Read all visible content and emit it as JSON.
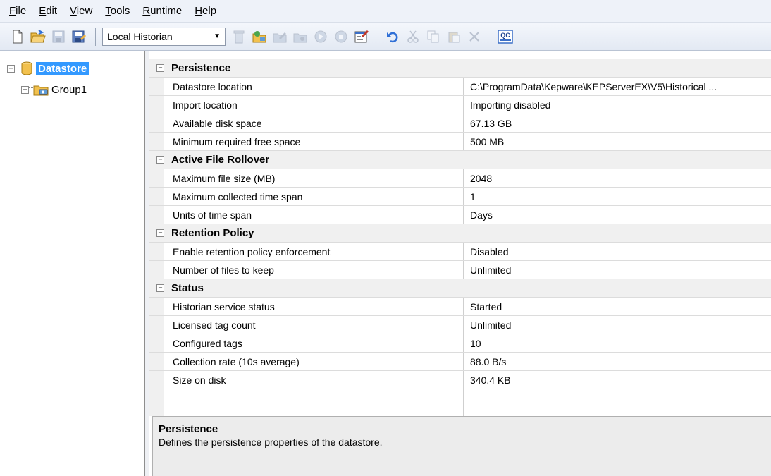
{
  "menu": [
    {
      "label": "File",
      "underline": "F",
      "rest": "ile"
    },
    {
      "label": "Edit",
      "underline": "E",
      "rest": "dit"
    },
    {
      "label": "View",
      "underline": "V",
      "rest": "iew"
    },
    {
      "label": "Tools",
      "underline": "T",
      "rest": "ools"
    },
    {
      "label": "Runtime",
      "underline": "R",
      "rest": "untime"
    },
    {
      "label": "Help",
      "underline": "H",
      "rest": "elp"
    }
  ],
  "toolbar": {
    "project_select": "Local Historian",
    "icons": [
      "new-icon",
      "open-icon",
      "save-icon",
      "save-as-icon",
      "delete-icon",
      "new-group-icon",
      "edit-icon",
      "new-tag-icon",
      "start-icon",
      "stop-icon",
      "properties-icon",
      "undo-icon",
      "cut-icon",
      "copy-icon",
      "paste-icon",
      "remove-icon",
      "quick-client-icon"
    ],
    "quick_client_label": "QC"
  },
  "tree": {
    "root": "Datastore",
    "child": "Group1"
  },
  "properties": {
    "persistence": {
      "title": "Persistence",
      "rows": [
        {
          "name": "Datastore location",
          "value": "C:\\ProgramData\\Kepware\\KEPServerEX\\V5\\Historical ..."
        },
        {
          "name": "Import location",
          "value": "Importing disabled"
        },
        {
          "name": "Available disk space",
          "value": "67.13 GB"
        },
        {
          "name": "Minimum required free space",
          "value": "500 MB"
        }
      ]
    },
    "rollover": {
      "title": "Active File Rollover",
      "rows": [
        {
          "name": "Maximum file size (MB)",
          "value": "2048"
        },
        {
          "name": "Maximum collected time span",
          "value": "1"
        },
        {
          "name": "Units of time span",
          "value": "Days"
        }
      ]
    },
    "retention": {
      "title": "Retention Policy",
      "rows": [
        {
          "name": "Enable retention policy enforcement",
          "value": "Disabled"
        },
        {
          "name": "Number of files to keep",
          "value": "Unlimited"
        }
      ]
    },
    "status": {
      "title": "Status",
      "rows": [
        {
          "name": "Historian service status",
          "value": "Started"
        },
        {
          "name": "Licensed tag count",
          "value": "Unlimited"
        },
        {
          "name": "Configured tags",
          "value": "10"
        },
        {
          "name": "Collection rate (10s average)",
          "value": "88.0 B/s"
        },
        {
          "name": "Size on disk",
          "value": "340.4 KB"
        }
      ]
    }
  },
  "description": {
    "title": "Persistence",
    "text": "Defines the persistence properties of the datastore."
  },
  "colors": {
    "selection": "#3399ff",
    "category_bg": "#f0f0f0",
    "menubar_bg": "#eef2f9"
  }
}
